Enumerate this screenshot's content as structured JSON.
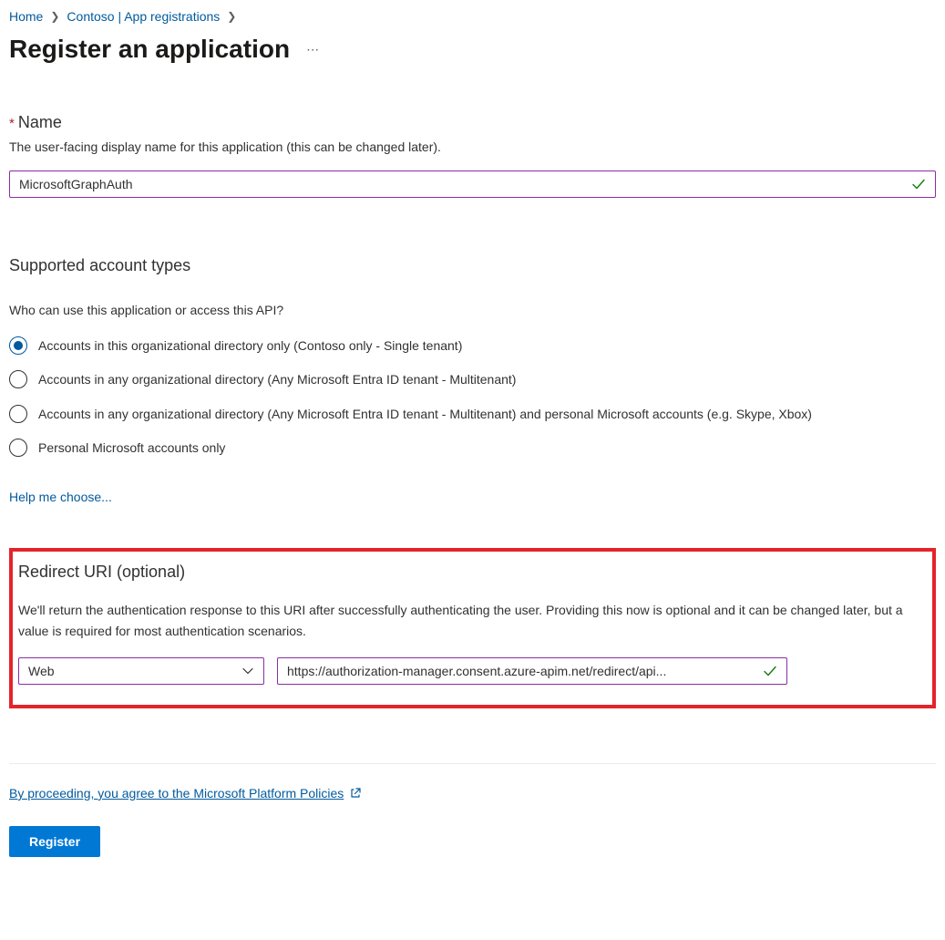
{
  "breadcrumb": {
    "home": "Home",
    "org": "Contoso | App registrations"
  },
  "page": {
    "title": "Register an application"
  },
  "name": {
    "label": "Name",
    "desc": "The user-facing display name for this application (this can be changed later).",
    "value": "MicrosoftGraphAuth"
  },
  "account_types": {
    "heading": "Supported account types",
    "question": "Who can use this application or access this API?",
    "options": [
      "Accounts in this organizational directory only (Contoso only - Single tenant)",
      "Accounts in any organizational directory (Any Microsoft Entra ID tenant - Multitenant)",
      "Accounts in any organizational directory (Any Microsoft Entra ID tenant - Multitenant) and personal Microsoft accounts (e.g. Skype, Xbox)",
      "Personal Microsoft accounts only"
    ],
    "selected_index": 0,
    "help_link": "Help me choose..."
  },
  "redirect": {
    "heading": "Redirect URI (optional)",
    "desc": "We'll return the authentication response to this URI after successfully authenticating the user. Providing this now is optional and it can be changed later, but a value is required for most authentication scenarios.",
    "platform": "Web",
    "uri": "https://authorization-manager.consent.azure-apim.net/redirect/api..."
  },
  "policies": {
    "text": "By proceeding, you agree to the Microsoft Platform Policies"
  },
  "buttons": {
    "register": "Register"
  }
}
